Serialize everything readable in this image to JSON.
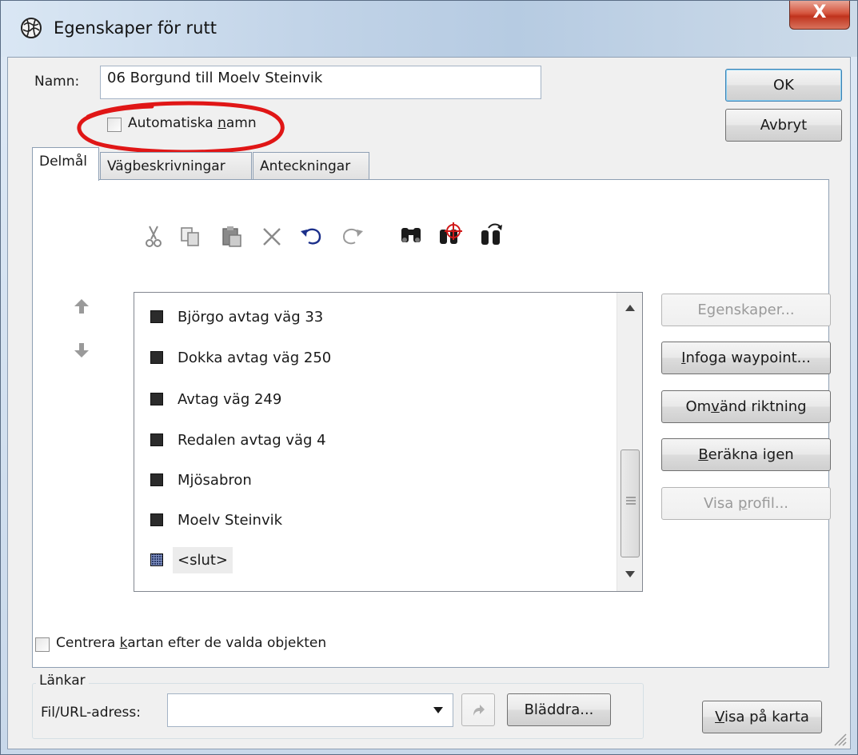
{
  "window": {
    "title": "Egenskaper för rutt",
    "close_label": "X"
  },
  "name_field": {
    "label": "Namn:",
    "value": "06 Borgund till Moelv Steinvik"
  },
  "auto_names": {
    "label_pre": "Automatiska ",
    "label_u": "n",
    "label_post": "amn",
    "checked": false
  },
  "buttons": {
    "ok": "OK",
    "cancel": "Avbryt"
  },
  "tabs": [
    {
      "label": "Delmål",
      "active": true
    },
    {
      "label": "Vägbeskrivningar",
      "active": false
    },
    {
      "label": "Anteckningar",
      "active": false
    }
  ],
  "toolbar": {
    "icons": [
      "cut-icon",
      "copy-icon",
      "paste-icon",
      "delete-icon",
      "undo-icon",
      "redo-icon",
      "find-icon",
      "find-nearest-icon",
      "find-next-icon"
    ]
  },
  "waypoints": [
    {
      "label": "Björgo avtag väg 33"
    },
    {
      "label": "Dokka avtag väg 250"
    },
    {
      "label": "Avtag väg 249"
    },
    {
      "label": "Redalen avtag väg 4"
    },
    {
      "label": "Mjösabron"
    },
    {
      "label": "Moelv Steinvik"
    },
    {
      "label": "<slut>"
    }
  ],
  "side_buttons": {
    "properties": "Egenskaper...",
    "insert_pre": "",
    "insert_u": "I",
    "insert_post": "nfoga waypoint...",
    "reverse_pre": "Om",
    "reverse_u": "v",
    "reverse_post": "änd riktning",
    "recalc_pre": "",
    "recalc_u": "B",
    "recalc_post": "eräkna igen",
    "profile_pre": "Visa ",
    "profile_u": "p",
    "profile_post": "rofil..."
  },
  "center_map": {
    "label_pre": "Centrera ",
    "label_u": "k",
    "label_post": "artan efter de valda objekten",
    "checked": false
  },
  "links": {
    "group_label": "Länkar",
    "url_label": "Fil/URL-adress:",
    "url_value": "",
    "browse": "Bläddra...",
    "show_pre": "",
    "show_u": "V",
    "show_post": "isa på karta"
  }
}
